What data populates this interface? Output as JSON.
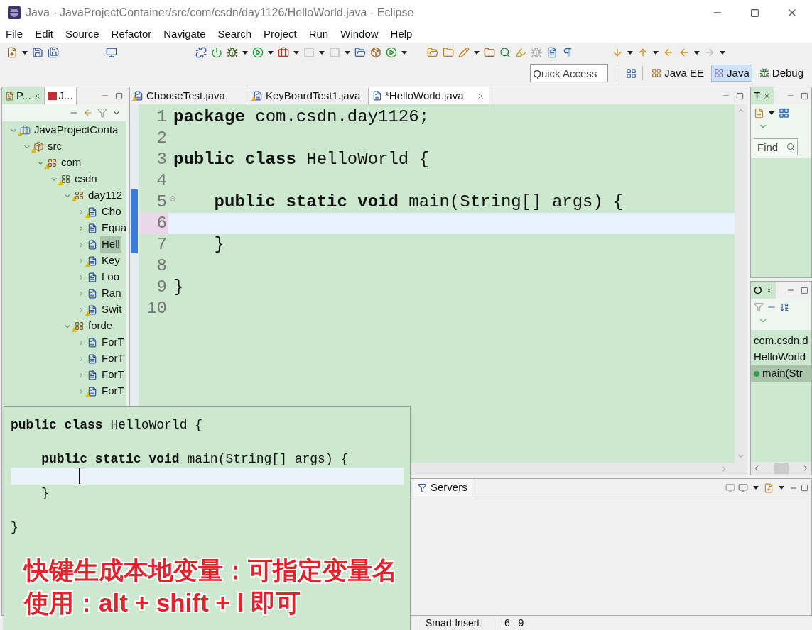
{
  "window": {
    "title": "Java - JavaProjectContainer/src/com/csdn/day1126/HelloWorld.java - Eclipse"
  },
  "menu": [
    "File",
    "Edit",
    "Source",
    "Refactor",
    "Navigate",
    "Search",
    "Project",
    "Run",
    "Window",
    "Help"
  ],
  "quick_access": {
    "placeholder": "Quick Access"
  },
  "perspectives": [
    {
      "label": "Java EE",
      "selected": false
    },
    {
      "label": "Java",
      "selected": true
    },
    {
      "label": "Debug",
      "selected": false
    }
  ],
  "left_panel": {
    "tabs": [
      {
        "label": "P...",
        "selected": true
      },
      {
        "label": "J...",
        "selected": false
      }
    ],
    "tree": [
      {
        "label": "JavaProjectConta",
        "kind": "project",
        "expanded": true,
        "selected": false,
        "warning": true,
        "children": [
          {
            "label": "src",
            "kind": "folder",
            "expanded": true,
            "selected": false,
            "warning": true,
            "children": [
              {
                "label": "com",
                "kind": "package",
                "expanded": true,
                "selected": false,
                "warning": true,
                "children": [
                  {
                    "label": "csdn",
                    "kind": "package",
                    "expanded": true,
                    "selected": false,
                    "warning": true,
                    "children": [
                      {
                        "label": "day112",
                        "kind": "package",
                        "expanded": true,
                        "selected": false,
                        "warning": true,
                        "children": [
                          {
                            "label": "Cho",
                            "kind": "file",
                            "expanded": false,
                            "selected": false,
                            "warning": true
                          },
                          {
                            "label": "Equa",
                            "kind": "file",
                            "expanded": false,
                            "selected": false,
                            "warning": false
                          },
                          {
                            "label": "Hell",
                            "kind": "file",
                            "expanded": false,
                            "selected": true,
                            "warning": false
                          },
                          {
                            "label": "Key",
                            "kind": "file",
                            "expanded": false,
                            "selected": false,
                            "warning": true
                          },
                          {
                            "label": "Loo",
                            "kind": "file",
                            "expanded": false,
                            "selected": false,
                            "warning": false
                          },
                          {
                            "label": "Ran",
                            "kind": "file",
                            "expanded": false,
                            "selected": false,
                            "warning": false
                          },
                          {
                            "label": "Swit",
                            "kind": "file",
                            "expanded": false,
                            "selected": false,
                            "warning": true
                          }
                        ]
                      },
                      {
                        "label": "forde",
                        "kind": "package",
                        "expanded": true,
                        "selected": false,
                        "warning": true,
                        "children": [
                          {
                            "label": "ForT",
                            "kind": "file",
                            "expanded": false,
                            "selected": false,
                            "warning": false
                          },
                          {
                            "label": "ForT",
                            "kind": "file",
                            "expanded": false,
                            "selected": false,
                            "warning": false
                          },
                          {
                            "label": "ForT",
                            "kind": "file",
                            "expanded": false,
                            "selected": false,
                            "warning": false
                          },
                          {
                            "label": "ForT",
                            "kind": "file",
                            "expanded": false,
                            "selected": false,
                            "warning": true
                          }
                        ]
                      }
                    ]
                  }
                ]
              }
            ]
          }
        ]
      }
    ]
  },
  "editor": {
    "tabs": [
      {
        "label": "ChooseTest.java",
        "selected": false,
        "warning": true
      },
      {
        "label": "KeyBoardTest1.java",
        "selected": false,
        "warning": true
      },
      {
        "label": "*HelloWorld.java",
        "selected": true,
        "warning": false
      }
    ],
    "lines": [
      {
        "number": "1",
        "code": "**package** com.csdn.day1126;",
        "current": false,
        "fold": false
      },
      {
        "number": "2",
        "current": false,
        "fold": false
      },
      {
        "number": "3",
        "code": "**public class** HelloWorld {",
        "current": false,
        "fold": false
      },
      {
        "number": "4",
        "current": false,
        "fold": false
      },
      {
        "number": "5",
        "code": "    **public static void** main(String[] args) {",
        "current": false,
        "fold": true
      },
      {
        "number": "6",
        "current": true,
        "fold": false
      },
      {
        "number": "7",
        "code": "    }",
        "current": false,
        "fold": false
      },
      {
        "number": "8",
        "current": false,
        "fold": false
      },
      {
        "number": "9",
        "code": "}",
        "current": false,
        "fold": false
      },
      {
        "number": "10",
        "current": false,
        "fold": false
      }
    ]
  },
  "right_top": {
    "tab": "T",
    "find": {
      "placeholder": "Find"
    }
  },
  "outline": {
    "tab": "O",
    "items": [
      {
        "label": "com.csdn.d",
        "selected": false
      },
      {
        "label": "HelloWorld",
        "selected": false
      },
      {
        "label": "main(Str",
        "selected": true
      }
    ]
  },
  "bottom_panel": {
    "tabs": [
      {
        "label": "Servers"
      }
    ]
  },
  "status_bar": [
    "Smart Insert",
    "6 : 9"
  ],
  "overlay": {
    "lines": [
      {
        "code": "**public class** HelloWorld {",
        "current": false
      },
      {
        "current": false
      },
      {
        "code": "    **public static void** main(String[] args) {",
        "current": false
      },
      {
        "current": true
      },
      {
        "code": "    }",
        "current": false
      },
      {
        "current": false
      },
      {
        "code": "}",
        "current": false
      }
    ],
    "caption": [
      "快键生成本地变量：可指定变量名",
      "使用：alt + shift + l 即可"
    ]
  }
}
